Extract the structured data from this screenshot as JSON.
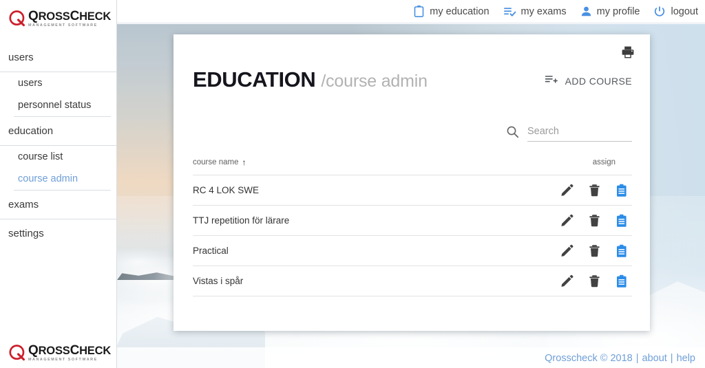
{
  "brand": {
    "name_q": "Q",
    "name_rest_1": "ROSS",
    "name_c": "C",
    "name_rest_2": "HECK",
    "tagline": "MANAGEMENT SOFTWARE",
    "logo_red": "#cc1f2b"
  },
  "topnav": {
    "items": [
      {
        "label": "my education",
        "icon": "clipboard-icon"
      },
      {
        "label": "my exams",
        "icon": "list-check-icon"
      },
      {
        "label": "my profile",
        "icon": "person-icon"
      },
      {
        "label": "logout",
        "icon": "power-icon"
      }
    ],
    "icon_color": "#4a90e2"
  },
  "sidebar": {
    "groups": [
      {
        "top": "users",
        "subs": [
          {
            "label": "users",
            "active": false
          },
          {
            "label": "personnel status",
            "active": false
          }
        ]
      },
      {
        "top": "education",
        "subs": [
          {
            "label": "course list",
            "active": false
          },
          {
            "label": "course admin",
            "active": true
          }
        ]
      }
    ],
    "plain_items": [
      {
        "label": "exams"
      },
      {
        "label": "settings"
      }
    ],
    "active_color": "#6f9fd8"
  },
  "card": {
    "title_strong": "EDUCATION",
    "title_light": "/course admin",
    "print_icon": "print-icon",
    "add_course": {
      "label": "ADD COURSE",
      "icon": "list-plus-icon"
    }
  },
  "search": {
    "icon": "search-icon",
    "placeholder": "Search",
    "value": ""
  },
  "table": {
    "columns": {
      "name": "course name",
      "sort_indicator": "↑",
      "assign": "assign"
    },
    "row_icons": {
      "edit": "pencil-icon",
      "delete": "trash-icon",
      "assign": "clipboard-assign-icon"
    },
    "icon_colors": {
      "edit": "#424242",
      "delete": "#424242",
      "assign": "#2b8ce8"
    },
    "rows": [
      {
        "name": "RC 4 LOK SWE"
      },
      {
        "name": "TTJ repetition för lärare"
      },
      {
        "name": "Practical"
      },
      {
        "name": "Vistas i spår"
      }
    ]
  },
  "footer": {
    "copyright": "Qrosscheck © 2018",
    "sep1": "|",
    "about": "about",
    "sep2": "|",
    "help": "help",
    "color": "#6f9fd8"
  }
}
